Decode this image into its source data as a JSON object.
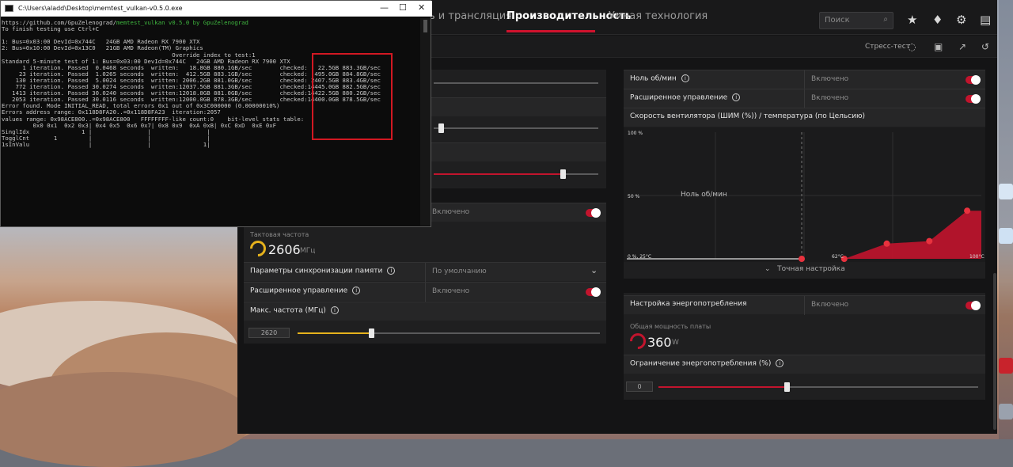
{
  "terminal": {
    "title": "C:\\Users\\aladd\\Desktop\\memtest_vulkan-v0.5.0.exe",
    "lines": [
      {
        "a": "https://github.com/GpuZelenograd/",
        "b": "memtest_vulkan v0.5.0 by GpuZelenograd",
        "c": ""
      },
      {
        "a": "To finish testing use Ctrl+C",
        "b": "",
        "c": ""
      },
      {
        "a": "",
        "b": "",
        "c": ""
      },
      {
        "a": "1: Bus=0x03:00 DevId=0x744C   24GB AMD Radeon RX 7900 XTX",
        "b": "",
        "c": ""
      },
      {
        "a": "2: Bus=0x10:00 DevId=0x13C0   21GB AMD Radeon(TM) Graphics",
        "b": "",
        "c": ""
      },
      {
        "a": "                                                 Override index to test:1",
        "b": "",
        "c": ""
      },
      {
        "a": "Standard 5-minute test of 1: Bus=0x03:00 DevId=0x744C   24GB AMD Radeon RX 7900 XTX",
        "b": "",
        "c": ""
      },
      {
        "a": "      1 iteration. Passed  0.0468 seconds  written:   18.8GB 880.1GB/sec        checked:   22.5GB 883.3GB/sec",
        "b": "",
        "c": ""
      },
      {
        "a": "     23 iteration. Passed  1.0265 seconds  written:  412.5GB 883.1GB/sec        checked:  495.0GB 884.8GB/sec",
        "b": "",
        "c": ""
      },
      {
        "a": "    130 iteration. Passed  5.0024 seconds  written: 2006.2GB 881.0GB/sec        checked: 2407.5GB 883.4GB/sec",
        "b": "",
        "c": ""
      },
      {
        "a": "    772 iteration. Passed 30.0274 seconds  written:12037.5GB 881.3GB/sec        checked:14445.0GB 882.5GB/sec",
        "b": "",
        "c": ""
      },
      {
        "a": "   1413 iteration. Passed 30.0240 seconds  written:12018.8GB 881.0GB/sec        checked:14422.5GB 880.2GB/sec",
        "b": "",
        "c": ""
      },
      {
        "a": "   2053 iteration. Passed 30.0116 seconds  written:12000.0GB 878.3GB/sec        checked:14400.0GB 878.5GB/sec",
        "b": "",
        "c": ""
      },
      {
        "a": "Error found. Mode INITIAL_READ, total errors 0x1 out of 0x3C000000 (0.00000010%)",
        "b": "",
        "c": ""
      },
      {
        "a": "Errors address range: 0x118D8FA20..=0x118D8FA23  iteration:2057",
        "b": "",
        "c": ""
      },
      {
        "a": "values range: 0x98ACE800..=0x98ACE800   FFFFFFFF-like count:0    bit-level stats table:",
        "b": "",
        "c": ""
      },
      {
        "a": "         0x0 0x1  0x2 0x3| 0x4 0x5  0x6 0x7| 0x8 0x9  0xA 0xB| 0xC 0xD  0xE 0xF",
        "b": "",
        "c": ""
      },
      {
        "a": "SinglIdx               1 |                |                |",
        "b": "",
        "c": ""
      },
      {
        "a": "TogglCnt       1         |                |                |",
        "b": "",
        "c": ""
      },
      {
        "a": "1sInValu                 |                |               1|",
        "b": "",
        "c": ""
      }
    ]
  },
  "nav": {
    "tab_stream": "ь и трансляция",
    "tab_performance": "Производительность",
    "tab_smart": "Умная технология",
    "search_placeholder": "Поиск"
  },
  "subbar": {
    "stress_test": "Стресс-тест"
  },
  "right": {
    "zero_rpm_label": "Ноль об/мин",
    "zero_rpm_value": "Включено",
    "adv_control_label": "Расширенное управление",
    "adv_control_value": "Включено",
    "fan_chart_title": "Скорость вентилятора (ШИМ (%)) / температура (по Цельсию)",
    "fine_tune": "Точная настройка",
    "power_label": "Настройка энергопотребления",
    "power_value": "Включено",
    "board_power_label": "Общая мощность платы",
    "board_power_value": "360",
    "board_power_unit": "W",
    "power_limit_label": "Ограничение энергопотребления (%)",
    "power_limit_value": "0"
  },
  "left": {
    "mem_toggle_value": "Включено",
    "clock_label": "Тактовая частота",
    "clock_value": "2606",
    "clock_unit": "МГц",
    "mem_timing_label": "Параметры синхронизации памяти",
    "mem_timing_value": "По умолчанию",
    "mem_adv_label": "Расширенное управление",
    "mem_adv_value": "Включено",
    "max_freq_label": "Макс. частота (МГц)",
    "max_freq_value": "2620"
  },
  "chart_data": {
    "type": "area",
    "title": "Скорость вентилятора (ШИМ (%)) / температура (по Цельсию)",
    "annotation": "Ноль об/мин",
    "y_tick_labels": [
      "100 %",
      "50 %",
      "0 %, 25°C"
    ],
    "x_tick_labels": [
      "62°C",
      "100°C"
    ],
    "xlim": [
      25,
      100
    ],
    "ylim": [
      0,
      100
    ],
    "series": [
      {
        "x": [
          62,
          71,
          80,
          89,
          97,
          100
        ],
        "values": [
          0,
          0,
          12,
          14,
          38,
          38
        ]
      }
    ],
    "accent_color": "#c2142d"
  },
  "slider_levels": {
    "left_top": 0.02,
    "left_mid": 0.06,
    "left_low": 0.77,
    "max_freq": 0.25,
    "power_limit": 0.5
  }
}
